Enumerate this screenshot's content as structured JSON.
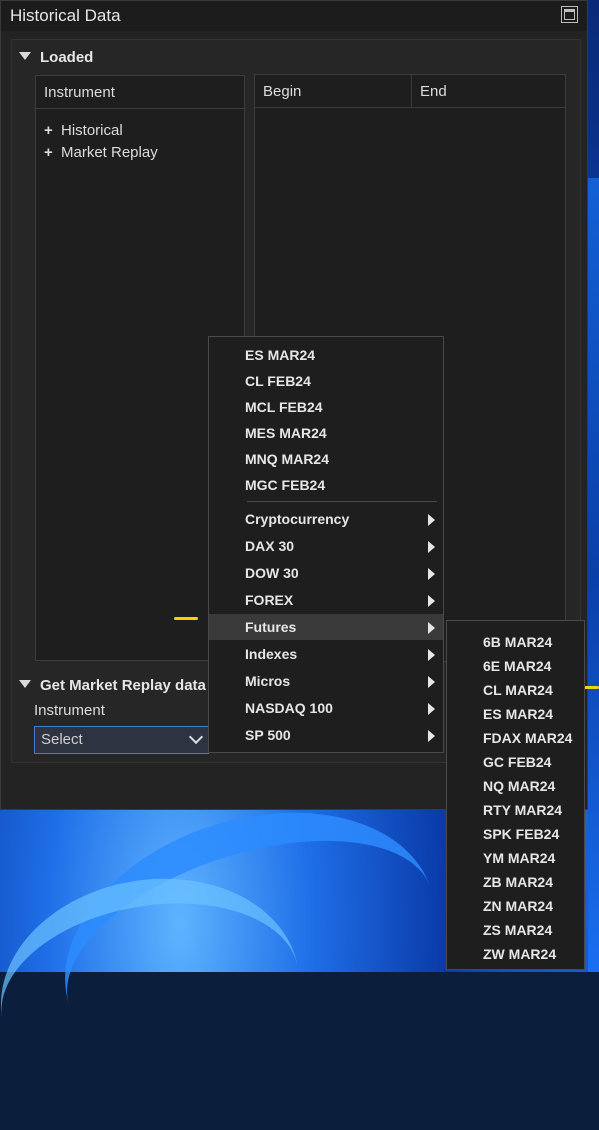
{
  "window": {
    "title": "Historical Data"
  },
  "loaded": {
    "header": "Loaded",
    "columns": {
      "instrument": "Instrument",
      "begin": "Begin",
      "end": "End"
    },
    "tree": [
      "Historical",
      "Market Replay"
    ]
  },
  "replay": {
    "header": "Get Market Replay data",
    "instrument_label": "Instrument",
    "select_value": "Select"
  },
  "menu": {
    "recent": [
      "ES MAR24",
      "CL FEB24",
      "MCL FEB24",
      "MES MAR24",
      "MNQ MAR24",
      "MGC FEB24"
    ],
    "categories": [
      "Cryptocurrency",
      "DAX 30",
      "DOW 30",
      "FOREX",
      "Futures",
      "Indexes",
      "Micros",
      "NASDAQ 100",
      "SP 500"
    ],
    "highlighted": "Futures"
  },
  "submenu": {
    "items": [
      "6B MAR24",
      "6E MAR24",
      "CL MAR24",
      "ES MAR24",
      "FDAX MAR24",
      "GC FEB24",
      "NQ MAR24",
      "RTY MAR24",
      "SPK FEB24",
      "YM MAR24",
      "ZB MAR24",
      "ZN MAR24",
      "ZS MAR24",
      "ZW MAR24"
    ]
  },
  "colors": {
    "annotation": "#f3d400",
    "select_border": "#3d7fcf"
  }
}
